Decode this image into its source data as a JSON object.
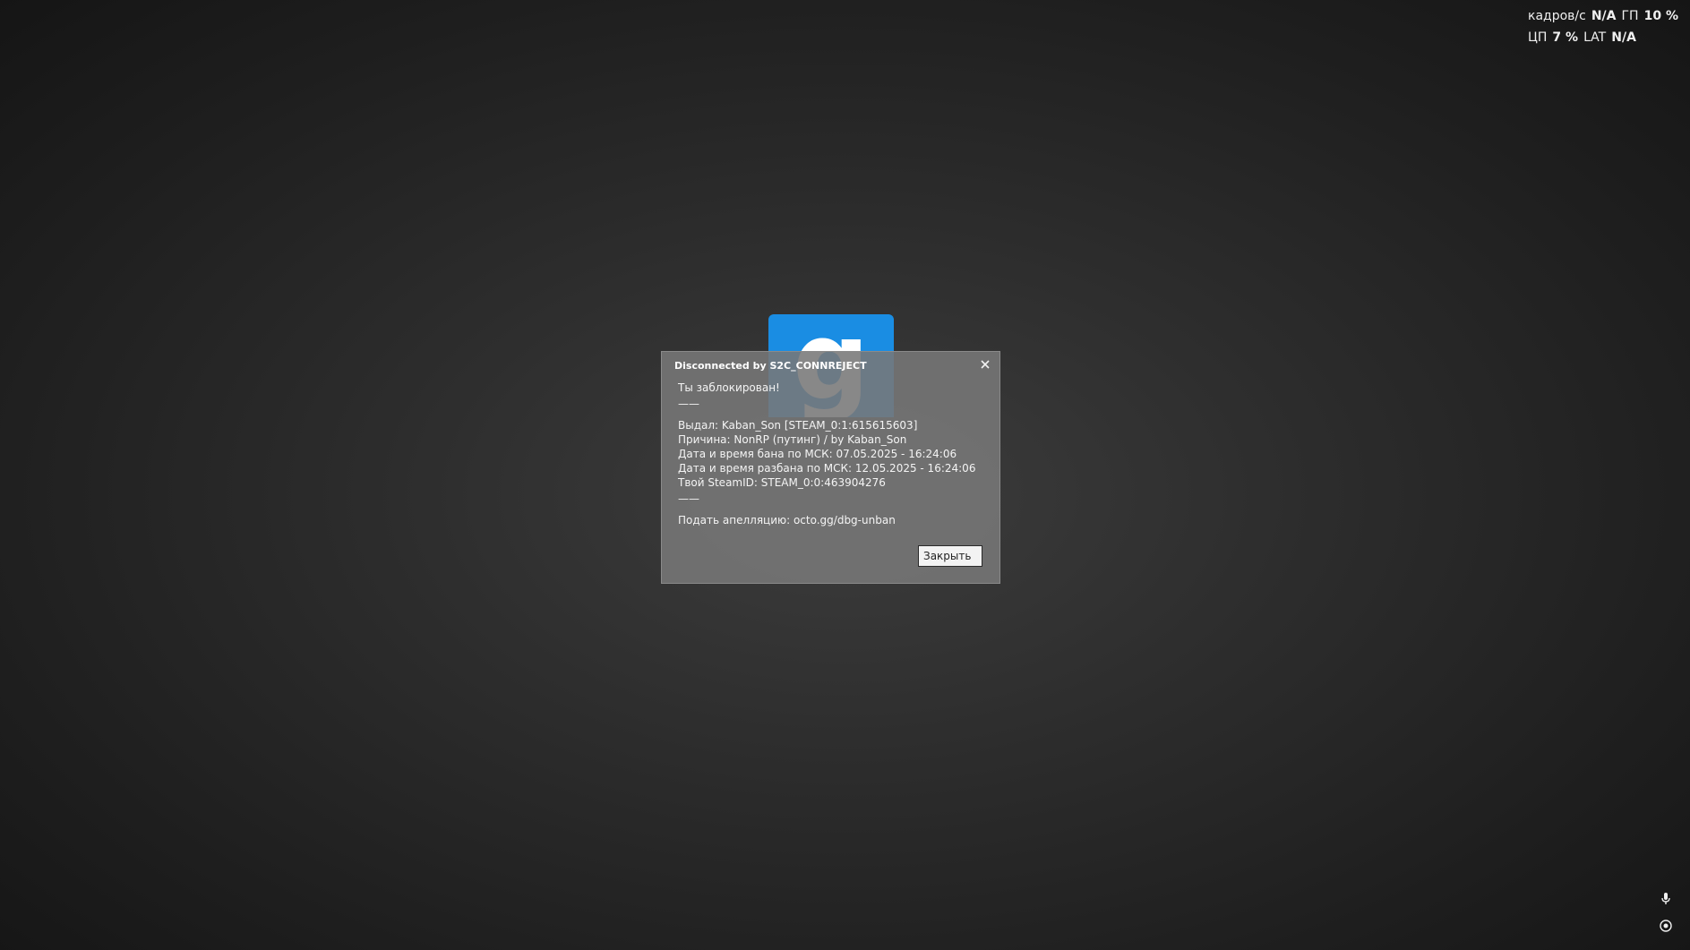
{
  "overlay": {
    "row1": [
      {
        "label": "кадров/с",
        "value": "N/A"
      },
      {
        "label": "ГП",
        "value": "10 %"
      }
    ],
    "row2": [
      {
        "label": "ЦП",
        "value": "7 %"
      },
      {
        "label": "LAT",
        "value": "N/A"
      }
    ]
  },
  "logo": {
    "glyph": "g",
    "color": "#1a8de3"
  },
  "dialog": {
    "title": "Disconnected by S2C_CONNREJECT",
    "close_icon": "close-icon",
    "lines": {
      "heading": "Ты заблокирован!",
      "sep1": "——",
      "issued": "Выдал: Kaban_Son [STEAM_0:1:615615603]",
      "reason": "Причина: NonRP (путинг) / by Kaban_Son",
      "ban_time": "Дата и время бана по МСК: 07.05.2025 - 16:24:06",
      "unban_time": "Дата и время разбана по МСК: 12.05.2025 - 16:24:06",
      "steamid": "Твой SteamID: STEAM_0:0:463904276",
      "sep2": "——",
      "appeal": "Подать апелляцию: octo.gg/dbg-unban"
    },
    "close_button": "Закрыть"
  },
  "tray": {
    "icons": [
      "microphone-icon",
      "record-icon"
    ]
  }
}
